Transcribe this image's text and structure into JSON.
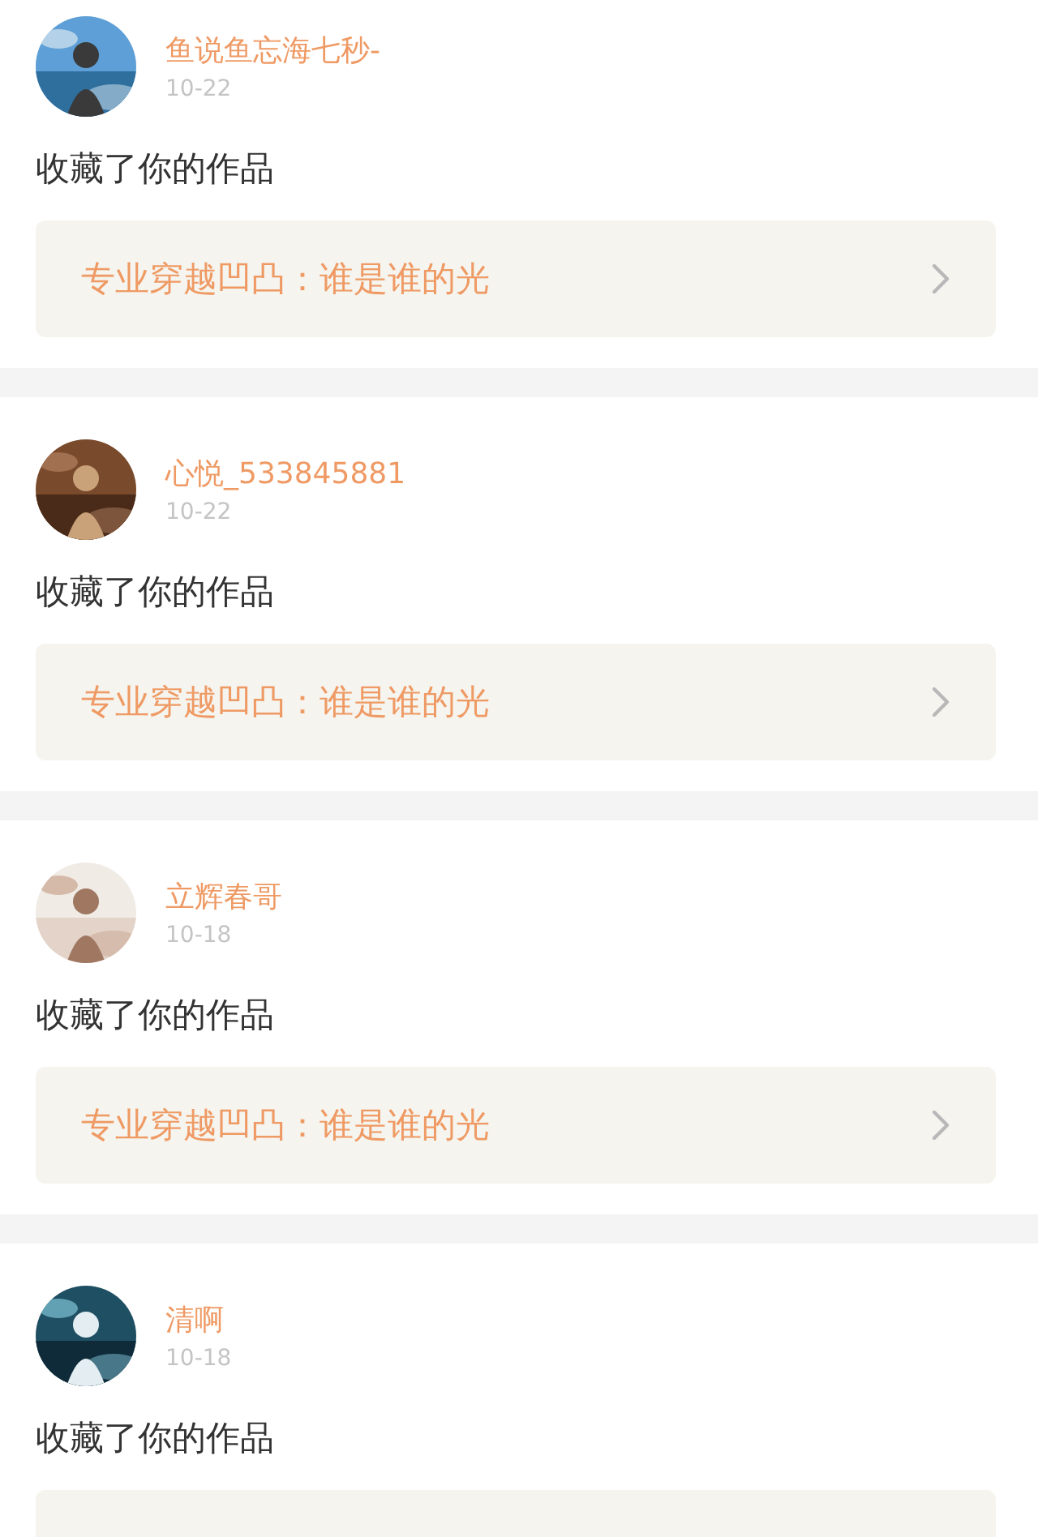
{
  "notifications": [
    {
      "user": "鱼说鱼忘海七秒-",
      "date": "10-22",
      "action": "收藏了你的作品",
      "work_title": "专业穿越凹凸：谁是谁的光"
    },
    {
      "user": "心悦_533845881",
      "date": "10-22",
      "action": "收藏了你的作品",
      "work_title": "专业穿越凹凸：谁是谁的光"
    },
    {
      "user": "立辉春哥",
      "date": "10-18",
      "action": "收藏了你的作品",
      "work_title": "专业穿越凹凸：谁是谁的光"
    },
    {
      "user": "清啊",
      "date": "10-18",
      "action": "收藏了你的作品"
    }
  ]
}
